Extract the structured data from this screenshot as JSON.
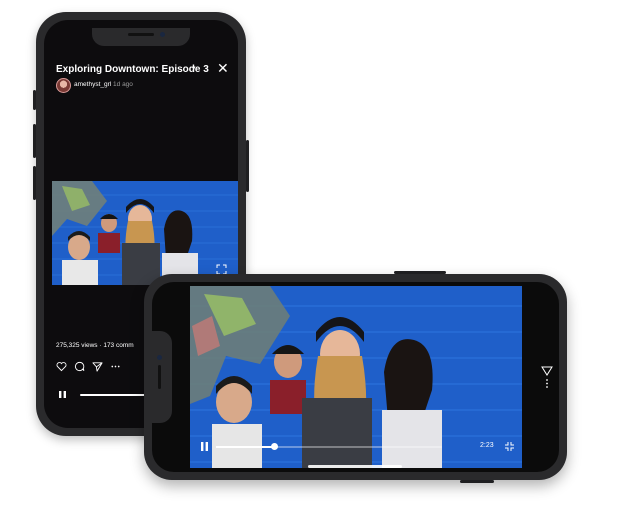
{
  "post": {
    "title": "Exploring Downtown: Episode 3",
    "username": "amethyst_grl",
    "posted_ago": "1d ago",
    "stats": "275,325 views · 173 comm"
  },
  "player": {
    "elapsed_time": "2:23",
    "landscape_progress": 0.26
  },
  "icons": {
    "dropdown": "chevron-down-icon",
    "close": "close-icon",
    "like": "heart-icon",
    "comment": "comment-icon",
    "share": "send-icon",
    "more": "more-icon",
    "play_pause": "pause-icon",
    "fullscreen": "expand-icon"
  },
  "colors": {
    "phone_frame": "#2a2a2c",
    "screen_bg": "#0d0c0e",
    "wall_blue": "#1f5fc9"
  }
}
